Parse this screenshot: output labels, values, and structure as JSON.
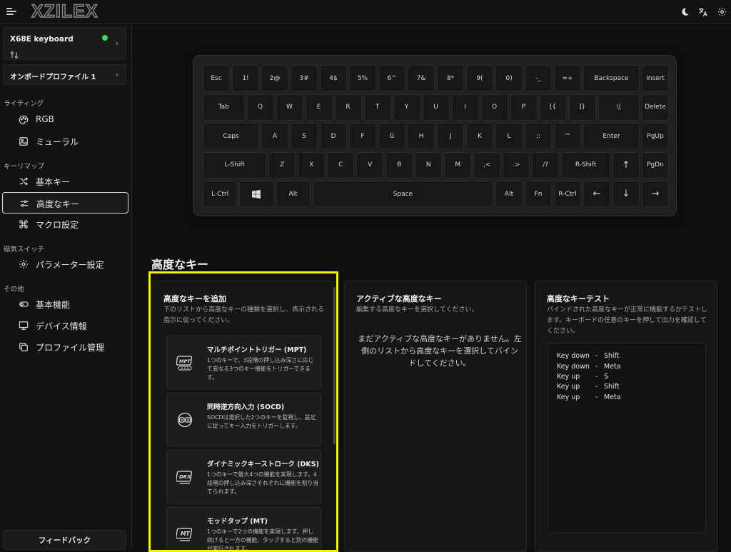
{
  "brand": {
    "logo": "XZILEX"
  },
  "topbar": {
    "theme_icon": "moon-icon",
    "lang_icon": "translate-icon",
    "settings_icon": "gear-icon"
  },
  "device": {
    "name": "X68E keyboard",
    "connected": true,
    "status_color": "#2ee35a"
  },
  "profile": {
    "name": "オンボードプロファイル 1"
  },
  "sidebar": {
    "sections": [
      {
        "label": "ライティング",
        "items": [
          {
            "label": "RGB",
            "icon": "palette-icon"
          },
          {
            "label": "ミューラル",
            "icon": "image-icon"
          }
        ]
      },
      {
        "label": "キーリマップ",
        "items": [
          {
            "label": "基本キー",
            "icon": "shuffle-icon"
          },
          {
            "label": "高度なキー",
            "icon": "sliders-icon",
            "active": true
          },
          {
            "label": "マクロ設定",
            "icon": "command-icon"
          }
        ]
      },
      {
        "label": "磁気スイッチ",
        "items": [
          {
            "label": "パラメーター設定",
            "icon": "gear-icon"
          }
        ]
      },
      {
        "label": "その他",
        "items": [
          {
            "label": "基本機能",
            "icon": "toggle-icon"
          },
          {
            "label": "デバイス情報",
            "icon": "monitor-icon"
          },
          {
            "label": "プロファイル管理",
            "icon": "copy-icon"
          }
        ]
      }
    ],
    "feedback": "フィードバック"
  },
  "keyboard": {
    "rows": [
      [
        "Esc",
        "1!",
        "2@",
        "3#",
        "4$",
        "5%",
        "6^",
        "7&",
        "8*",
        "9(",
        "0)",
        "-_",
        "=+",
        "Backspace",
        "Insert"
      ],
      [
        "Tab",
        "Q",
        "W",
        "E",
        "R",
        "T",
        "Y",
        "U",
        "I",
        "O",
        "P",
        "[{",
        "]}",
        "\\|",
        "Delete"
      ],
      [
        "Caps",
        "A",
        "S",
        "D",
        "F",
        "G",
        "H",
        "J",
        "K",
        "L",
        ";:",
        "'\"",
        "Enter",
        "PgUp"
      ],
      [
        "L-Shift",
        "Z",
        "X",
        "C",
        "V",
        "B",
        "N",
        "M",
        ",<",
        ".>",
        "/?",
        "R-Shift",
        "↑",
        "PgDn"
      ],
      [
        "L-Ctrl",
        "",
        "Alt",
        "Space",
        "Alt",
        "Fn",
        "R-Ctrl",
        "←",
        "↓",
        "→"
      ]
    ]
  },
  "main": {
    "title": "高度なキー",
    "add_panel": {
      "title": "高度なキーを追加",
      "desc": "下のリストから高度なキーの種類を選択し、表示される指示に従ってください。",
      "items": [
        {
          "title": "マルチポイントトリガー (MPT)",
          "desc": "1つのキーで、3段階の押し込み深さに応じて異なる3つのキー機能をトリガーできます。",
          "icon": "mpt-icon"
        },
        {
          "title": "同時逆方向入力 (SOCD)",
          "desc": "SOCDは選択した2つのキーを監視し、設定に従ってキー入力をトリガーします。",
          "icon": "socd-icon"
        },
        {
          "title": "ダイナミックキーストローク (DKS)",
          "desc": "1つのキーで最大4つの機能を実現します。4段階の押し込み深さそれぞれに機能を割り当てられます。",
          "icon": "dks-icon"
        },
        {
          "title": "モッドタップ (MT)",
          "desc": "1つのキーで2つの機能を実現します。押し続けると一方の機能、タップすると別の機能が実行されます。",
          "icon": "mt-icon"
        }
      ]
    },
    "active_panel": {
      "title": "アクティブな高度なキー",
      "desc": "編集する高度なキーを選択してください。",
      "empty": "まだアクティブな高度なキーがありません。左側のリストから高度なキーを選択してバインドしてください。"
    },
    "test_panel": {
      "title": "高度なキーテスト",
      "desc": "バインドされた高度なキーが正常に機能するかテストします。キーボードの任意のキーを押して出力を確認してください。",
      "log": [
        {
          "event": "Key down",
          "key": "Shift"
        },
        {
          "event": "Key down",
          "key": "Meta"
        },
        {
          "event": "Key up",
          "key": "S"
        },
        {
          "event": "Key up",
          "key": "Shift"
        },
        {
          "event": "Key up",
          "key": "Meta"
        }
      ]
    }
  }
}
